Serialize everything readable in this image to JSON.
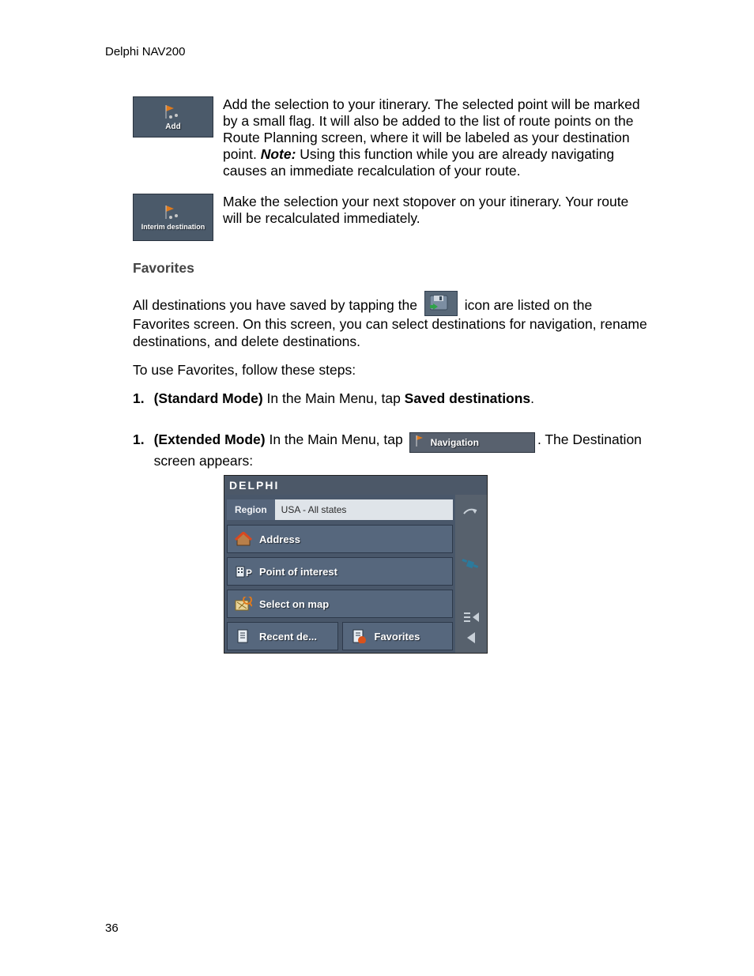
{
  "header": {
    "product": "Delphi NAV200"
  },
  "icon_row_1": {
    "button_label": "Add",
    "text_before_note": "Add the selection to your itinerary. The selected point will be marked by a small flag. It will also be added to the list of route points on the Route Planning screen, where it will be labeled as your destination point. ",
    "note_label": "Note:",
    "text_after_note": " Using this function while you are already navigating causes an immediate recalculation of your route."
  },
  "icon_row_2": {
    "button_label": "Interim destination",
    "text": "Make the selection your next stopover on your itinerary. Your route will be recalculated immediately."
  },
  "section_heading": "Favorites",
  "favorites_intro": {
    "part_a": "All destinations you have saved by tapping the",
    "part_b": "icon are listed on the Favorites screen. On this screen, you can select destinations for navigation, rename destinations, and delete destinations."
  },
  "favorites_lead": "To use Favorites, follow these steps:",
  "steps": [
    {
      "number": "1.",
      "mode": "(Standard Mode)",
      "text_a": " In the Main Menu, tap ",
      "strong": "Saved destinations",
      "text_b": "."
    },
    {
      "number": "1.",
      "mode": "(Extended Mode)",
      "text_a": " In the Main Menu, tap ",
      "nav_button_label": "Navigation",
      "text_b": ". The Destination screen appears:"
    }
  ],
  "dest_screen": {
    "logo": "DELPHI",
    "region_label": "Region",
    "region_value": "USA - All states",
    "buttons": {
      "address": "Address",
      "poi": "Point of interest",
      "map": "Select on map",
      "recent": "Recent de...",
      "favorites": "Favorites"
    }
  },
  "page_number": "36"
}
